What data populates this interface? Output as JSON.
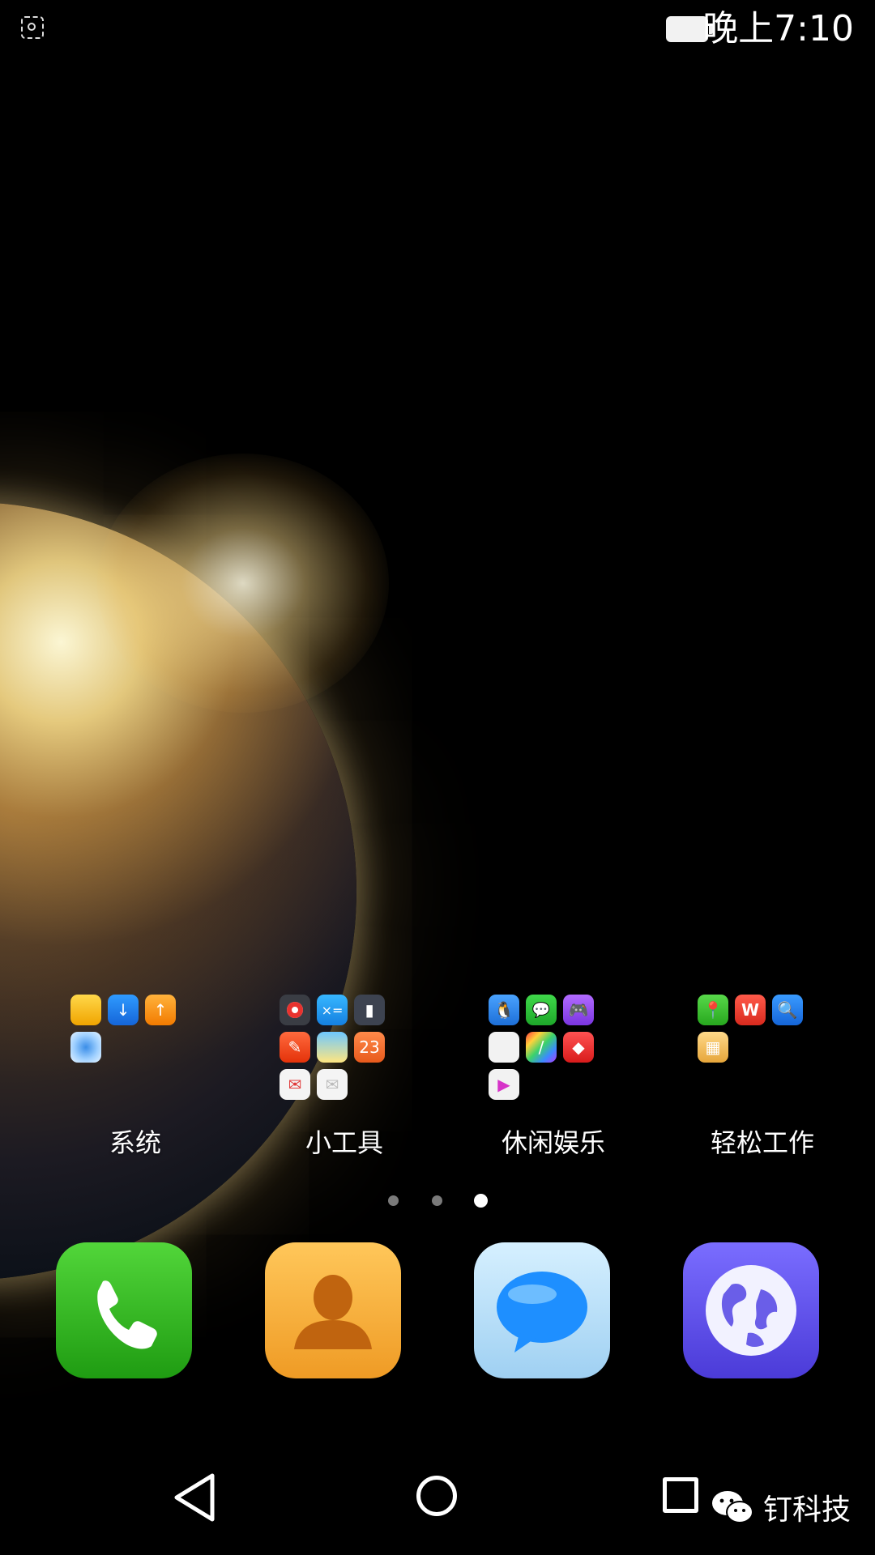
{
  "status_bar": {
    "time": "晚上7:10",
    "icons": [
      "screenshot-icon",
      "battery-icon"
    ]
  },
  "wallpaper": "earth-sunrise",
  "folders": [
    {
      "label": "系统",
      "apps": [
        "file-manager-icon",
        "download-icon",
        "update-icon",
        "safari-compass-icon"
      ]
    },
    {
      "label": "小工具",
      "apps": [
        "recorder-icon",
        "calculator-icon",
        "flashlight-icon",
        "compass-icon",
        "weather-icon",
        "calendar-icon",
        "mail-icon",
        "note-icon"
      ],
      "calendar_day": "23"
    },
    {
      "label": "休闲娱乐",
      "apps": [
        "qq-icon",
        "wechat-icon",
        "game-icon",
        "app-store-icon",
        "theme-icon",
        "puzzle-icon",
        "video-icon"
      ]
    },
    {
      "label": "轻松工作",
      "apps": [
        "maps-icon",
        "wps-office-icon",
        "search-icon",
        "sim-toolkit-icon"
      ]
    }
  ],
  "pagination": {
    "pages": 3,
    "current": 3
  },
  "dock": [
    {
      "name": "phone-icon"
    },
    {
      "name": "contacts-icon"
    },
    {
      "name": "messages-icon"
    },
    {
      "name": "browser-icon"
    }
  ],
  "navigation": {
    "icons": [
      "back-icon",
      "home-icon",
      "recent-apps-icon"
    ]
  },
  "watermark": {
    "text": "钉科技",
    "icon": "wechat-logo-icon"
  }
}
